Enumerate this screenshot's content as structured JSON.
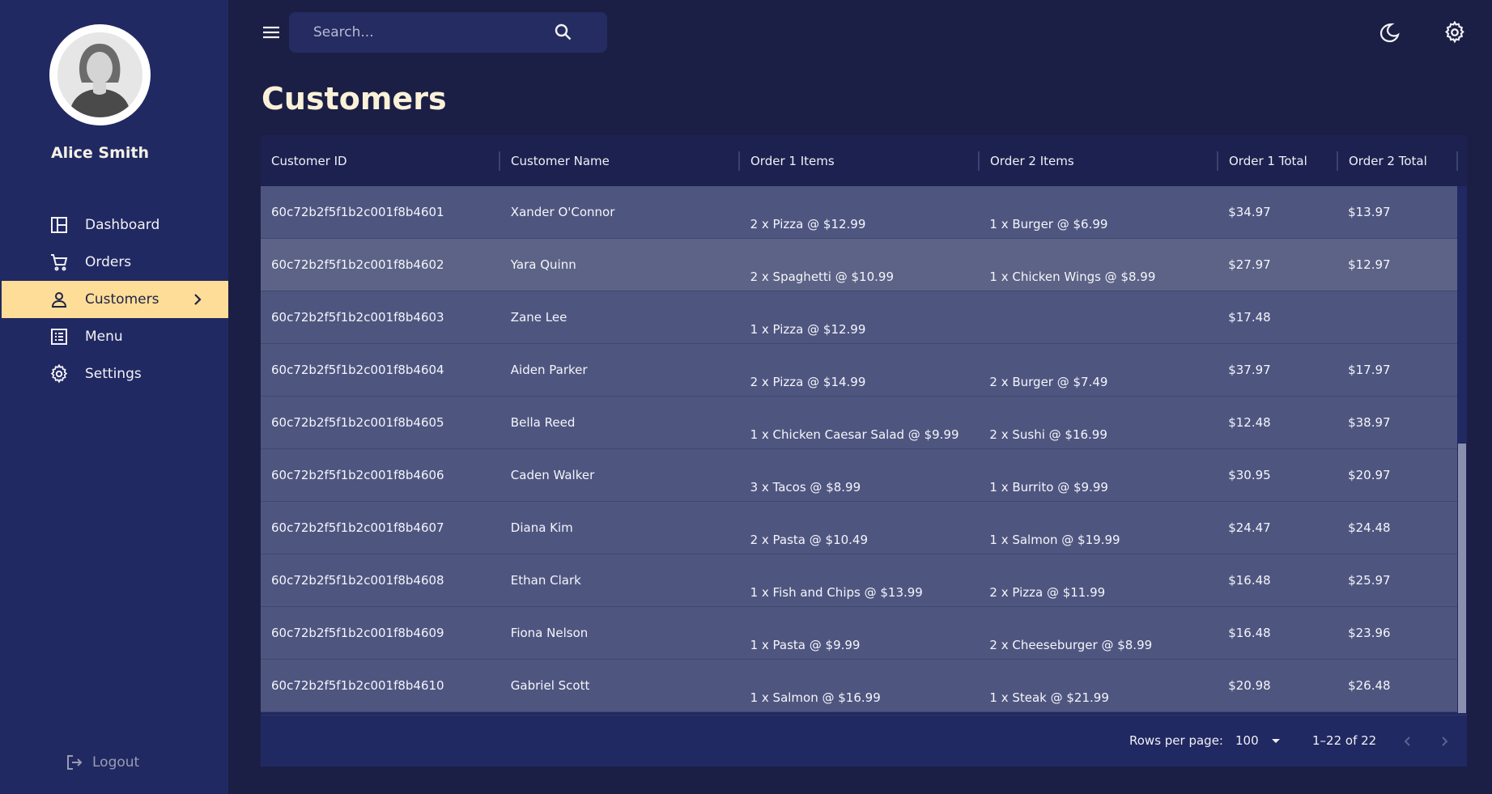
{
  "user": {
    "name": "Alice Smith"
  },
  "sidebar": {
    "items": [
      {
        "label": "Dashboard",
        "icon": "dashboard-icon"
      },
      {
        "label": "Orders",
        "icon": "cart-icon"
      },
      {
        "label": "Customers",
        "icon": "person-icon",
        "active": true
      },
      {
        "label": "Menu",
        "icon": "list-icon"
      },
      {
        "label": "Settings",
        "icon": "gear-icon"
      }
    ],
    "logout_label": "Logout"
  },
  "search": {
    "placeholder": "Search..."
  },
  "page": {
    "title": "Customers"
  },
  "table": {
    "columns": [
      "Customer ID",
      "Customer Name",
      "Order 1 Items",
      "Order 2 Items",
      "Order 1 Total",
      "Order 2 Total"
    ],
    "rows": [
      [
        "60c72b2f5f1b2c001f8b4601",
        "Xander O'Connor",
        "2 x Pizza @ $12.99",
        "1 x Burger @ $6.99",
        "$34.97",
        "$13.97"
      ],
      [
        "60c72b2f5f1b2c001f8b4602",
        "Yara Quinn",
        "2 x Spaghetti @ $10.99",
        "1 x Chicken Wings @ $8.99",
        "$27.97",
        "$12.97"
      ],
      [
        "60c72b2f5f1b2c001f8b4603",
        "Zane Lee",
        "1 x Pizza @ $12.99",
        "",
        "$17.48",
        ""
      ],
      [
        "60c72b2f5f1b2c001f8b4604",
        "Aiden Parker",
        "2 x Pizza @ $14.99",
        "2 x Burger @ $7.49",
        "$37.97",
        "$17.97"
      ],
      [
        "60c72b2f5f1b2c001f8b4605",
        "Bella Reed",
        "1 x Chicken Caesar Salad @ $9.99",
        "2 x Sushi @ $16.99",
        "$12.48",
        "$38.97"
      ],
      [
        "60c72b2f5f1b2c001f8b4606",
        "Caden Walker",
        "3 x Tacos @ $8.99",
        "1 x Burrito @ $9.99",
        "$30.95",
        "$20.97"
      ],
      [
        "60c72b2f5f1b2c001f8b4607",
        "Diana Kim",
        "2 x Pasta @ $10.49",
        "1 x Salmon @ $19.99",
        "$24.47",
        "$24.48"
      ],
      [
        "60c72b2f5f1b2c001f8b4608",
        "Ethan Clark",
        "1 x Fish and Chips @ $13.99",
        "2 x Pizza @ $11.99",
        "$16.48",
        "$25.97"
      ],
      [
        "60c72b2f5f1b2c001f8b4609",
        "Fiona Nelson",
        "1 x Pasta @ $9.99",
        "2 x Cheeseburger @ $8.99",
        "$16.48",
        "$23.96"
      ],
      [
        "60c72b2f5f1b2c001f8b4610",
        "Gabriel Scott",
        "1 x Salmon @ $16.99",
        "1 x Steak @ $21.99",
        "$20.98",
        "$26.48"
      ]
    ]
  },
  "pagination": {
    "rows_per_page_label": "Rows per page:",
    "rows_per_page_value": "100",
    "range": "1–22 of 22"
  },
  "colors": {
    "background": "#1b1f45",
    "sidebar": "#212962",
    "accent": "#fddd97",
    "row": "#4e5680"
  }
}
